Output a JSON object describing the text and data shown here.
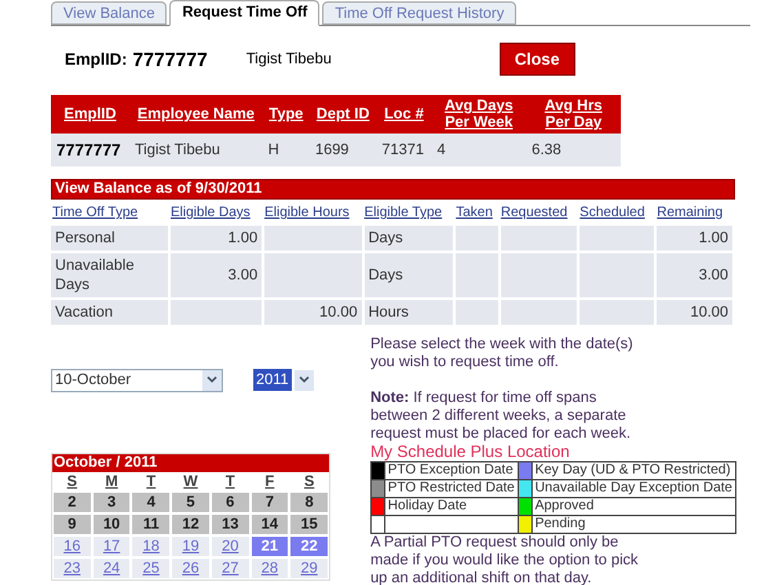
{
  "tabs": [
    {
      "label": "View Balance",
      "selected": false
    },
    {
      "label": "Request Time Off",
      "selected": true
    },
    {
      "label": "Time Off Request History",
      "selected": false
    }
  ],
  "employee": {
    "label": "EmplID:",
    "id": "7777777",
    "name": "Tigist Tibebu"
  },
  "close_button": "Close",
  "employee_table": {
    "columns": [
      "EmplID",
      "Employee Name",
      "Type",
      "Dept ID",
      "Loc #",
      "Avg Days Per Week",
      "Avg Hrs Per Day"
    ],
    "rows": [
      [
        "7777777",
        "Tigist Tibebu",
        "H",
        "1699",
        "71371",
        "4",
        "6.38"
      ]
    ]
  },
  "balance_table": {
    "title": "View Balance as of 9/30/2011",
    "columns": [
      "Time Off Type",
      "Eligible Days",
      "Eligible Hours",
      "Eligible Type",
      "Taken",
      "Requested",
      "Scheduled",
      "Remaining"
    ],
    "rows": [
      [
        "Personal",
        "1.00",
        "",
        "Days",
        "",
        "",
        "",
        "1.00"
      ],
      [
        "Unavailable Days",
        "3.00",
        "",
        "Days",
        "",
        "",
        "",
        "3.00"
      ],
      [
        "Vacation",
        "",
        "10.00",
        "Hours",
        "",
        "",
        "",
        "10.00"
      ]
    ]
  },
  "week_select": {
    "value": "10-October"
  },
  "year_select": {
    "value": "2011"
  },
  "calendar": {
    "title": "October / 2011",
    "weekdays": [
      "S",
      "M",
      "T",
      "W",
      "T",
      "F",
      "S"
    ],
    "weeks": [
      [
        {
          "day": "2",
          "kind": "past"
        },
        {
          "day": "3",
          "kind": "past"
        },
        {
          "day": "4",
          "kind": "past"
        },
        {
          "day": "5",
          "kind": "past"
        },
        {
          "day": "6",
          "kind": "past"
        },
        {
          "day": "7",
          "kind": "past"
        },
        {
          "day": "8",
          "kind": "past"
        }
      ],
      [
        {
          "day": "9",
          "kind": "past"
        },
        {
          "day": "10",
          "kind": "past"
        },
        {
          "day": "11",
          "kind": "past"
        },
        {
          "day": "12",
          "kind": "past"
        },
        {
          "day": "13",
          "kind": "past"
        },
        {
          "day": "14",
          "kind": "past"
        },
        {
          "day": "15",
          "kind": "past"
        }
      ],
      [
        {
          "day": "16",
          "kind": "link"
        },
        {
          "day": "17",
          "kind": "link"
        },
        {
          "day": "18",
          "kind": "link"
        },
        {
          "day": "19",
          "kind": "link"
        },
        {
          "day": "20",
          "kind": "link"
        },
        {
          "day": "21",
          "kind": "link",
          "color": "#7b7bf0"
        },
        {
          "day": "22",
          "kind": "link",
          "color": "#7b7bf0"
        }
      ],
      [
        {
          "day": "23",
          "kind": "link"
        },
        {
          "day": "24",
          "kind": "link"
        },
        {
          "day": "25",
          "kind": "link"
        },
        {
          "day": "26",
          "kind": "link"
        },
        {
          "day": "27",
          "kind": "link"
        },
        {
          "day": "28",
          "kind": "link"
        },
        {
          "day": "29",
          "kind": "link"
        }
      ]
    ]
  },
  "instructions": "Please select the week with the date(s) you wish to request time off.",
  "note": "**Note:** If request for time off spans between 2 different weeks, a separate request must be placed for each week.",
  "schedule_link": "My Schedule Plus Location",
  "legend": [
    [
      {
        "color": "#000000",
        "label": "PTO Exception Date"
      },
      {
        "color": "#7b7bf0",
        "label": "Key Day (UD & PTO Restricted)"
      }
    ],
    [
      {
        "color": "#8c8c8c",
        "label": "PTO Restricted Date"
      },
      {
        "color": "#44e6ef",
        "label": "Unavailable Day Exception Date"
      }
    ],
    [
      {
        "color": "#ff0000",
        "label": "Holiday Date"
      },
      {
        "color": "#00e000",
        "label": "Approved"
      }
    ],
    [
      {
        "color": "#ffffff"
      },
      {
        "color": "#f0f000",
        "label": "Pending"
      }
    ]
  ],
  "partial_note": "A Partial PTO request should only be made if you would like the option to pick up an additional shift on that day."
}
